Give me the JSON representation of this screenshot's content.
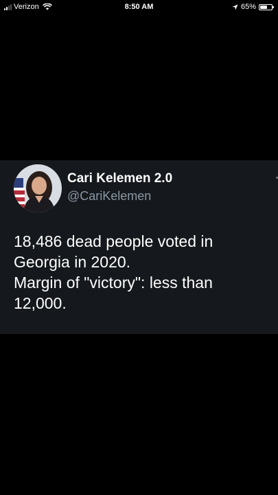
{
  "status_bar": {
    "carrier": "Verizon",
    "time": "8:50 AM",
    "battery_percent": "65%",
    "battery_level": 0.65,
    "icons": [
      "signal-icon",
      "wifi-icon",
      "location-arrow-icon",
      "battery-icon"
    ]
  },
  "tweet": {
    "display_name": "Cari Kelemen 2.0",
    "handle": "@CariKelemen",
    "text_lines": [
      "18,486 dead people voted in",
      "Georgia in 2020.",
      "Margin of \"victory\": less than",
      "12,000."
    ]
  },
  "colors": {
    "background": "#000000",
    "card_background": "#15181c",
    "primary_text": "#ffffff",
    "secondary_text": "#8b98a5"
  }
}
